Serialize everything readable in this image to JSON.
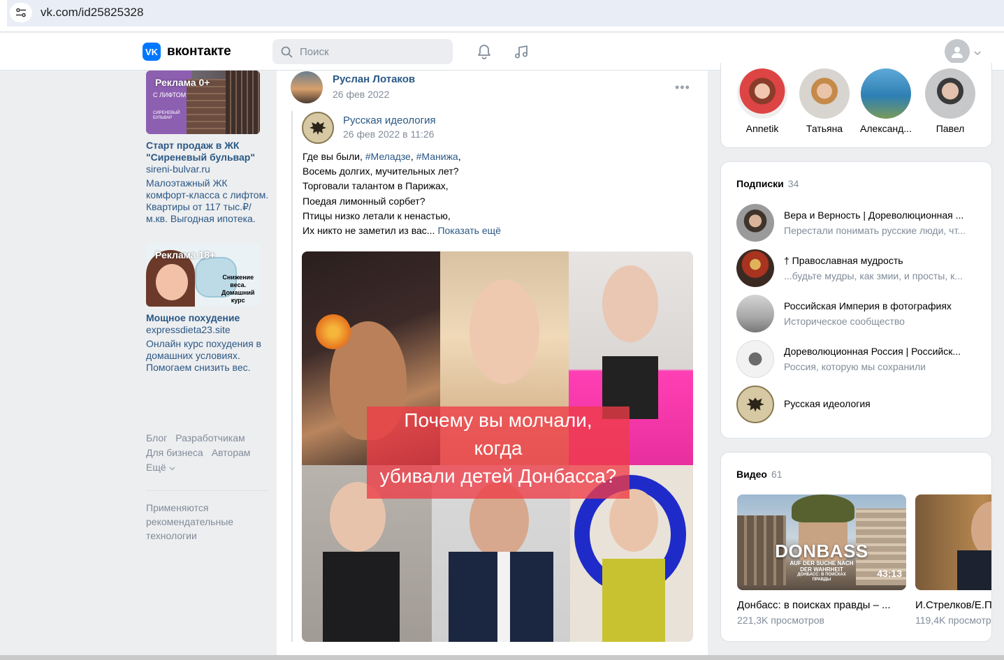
{
  "browser": {
    "url": "vk.com/id25825328"
  },
  "header": {
    "logo_text": "вконтакте",
    "logo_mark": "VK",
    "search_placeholder": "Поиск"
  },
  "ads": [
    {
      "badge": "Реклама 0+",
      "title": "Старт продаж в ЖК \"Сиреневый бульвар\"",
      "domain": "sireni-bulvar.ru",
      "text": "Малоэтажный ЖК комфорт-класса с лифтом. Квартиры от 117 тыс.₽/м.кв. Выгодная ипотека."
    },
    {
      "badge": "Реклама 18+",
      "title": "Мощное похудение",
      "domain": "expressdieta23.site",
      "text": "Онлайн курс похудения в домашних условиях. Помогаем снизить вес."
    }
  ],
  "footer": {
    "links": [
      "Блог",
      "Разработчикам",
      "Для бизнеса",
      "Авторам"
    ],
    "more": "Ещё",
    "recs": "Применяются рекомендательные технологии"
  },
  "post": {
    "author": "Руслан Лотаков",
    "date": "26 фев 2022",
    "more_icon": "•••",
    "repost": {
      "author": "Русская идеология",
      "date": "26 фев 2022 в 11:26",
      "line1_prefix": "Где вы были, ",
      "tag1": "#Меладзе",
      "sep": ", ",
      "tag2": "#Манижа",
      "line1_suffix": ",",
      "lines": [
        "Восемь долгих, мучительных лет?",
        "Торговали талантом в Парижах,",
        "Поедая лимонный сорбет?",
        "Птицы низко летали к ненастью,"
      ],
      "last_line": "Их никто не заметил из вас...",
      "show_more": "Показать ещё"
    },
    "image_caption": [
      "Почему вы молчали,",
      "когда",
      "убивали детей Донбасса?"
    ]
  },
  "friends": [
    {
      "name": "Annetik",
      "color": "#c9302c"
    },
    {
      "name": "Татьяна",
      "color": "#c7a17a"
    },
    {
      "name": "Александ...",
      "color": "#3f8fbf"
    },
    {
      "name": "Павел",
      "color": "#555b61"
    }
  ],
  "subscriptions": {
    "title": "Подписки",
    "count": "34",
    "items": [
      {
        "name": "Вера и Верность | Дореволюционная ...",
        "desc": "Перестали понимать русские люди, чт...",
        "color": "#6b5a4a"
      },
      {
        "name": "† Православная мудрость",
        "desc": "...будьте мудры, как змии, и просты, к...",
        "color": "#8a2f1f"
      },
      {
        "name": "Российская Империя в фотографиях",
        "desc": "Историческое сообщество",
        "color": "#b8b8b8"
      },
      {
        "name": "Дореволюционная Россия | Российск...",
        "desc": "Россия, которую мы сохранили",
        "color": "#e9e9e9"
      },
      {
        "name": "Русская идеология",
        "desc": "",
        "color": "#d6c9a4"
      }
    ]
  },
  "videos": {
    "title": "Видео",
    "count": "61",
    "items": [
      {
        "title": "Донбасс: в поисках правды – ...",
        "views": "221,3K просмотров",
        "duration": "43:13",
        "thumb_text": "DONBASS",
        "thumb_sub1": "AUF DER SUCHE NACH",
        "thumb_sub2": "DER WAHRHEIT",
        "thumb_sub3": "ДОНБАСС: В ПОИСКАХ",
        "thumb_sub4": "ПРАВДЫ"
      },
      {
        "title": "И.Стрелков/Е.П",
        "views": "119,4K просмотр",
        "duration": ""
      }
    ]
  }
}
